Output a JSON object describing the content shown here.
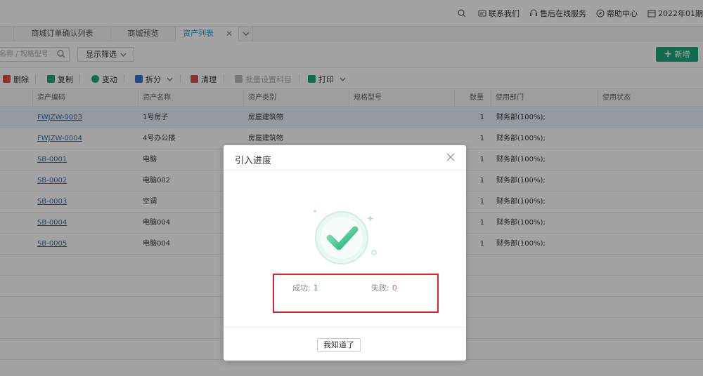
{
  "header": {
    "contact": "联系我们",
    "online_service": "售后在线服务",
    "help": "帮助中心",
    "date": "2022年01期"
  },
  "tabs": [
    {
      "label": "商城订单确认列表",
      "active": false
    },
    {
      "label": "商城预览",
      "active": false
    },
    {
      "label": "资产列表",
      "active": true
    }
  ],
  "search": {
    "placeholder": "名称 / 规格型号",
    "filter_label": "显示筛选",
    "add_label": "新增"
  },
  "toolbar": {
    "delete": "删除",
    "copy": "复制",
    "change": "变动",
    "split": "拆分",
    "clear": "清理",
    "batch_subject": "批量设置科目",
    "print": "打印"
  },
  "table": {
    "columns": [
      "资产编码",
      "资产名称",
      "资产类别",
      "规格型号",
      "数量",
      "使用部门",
      "使用状态"
    ],
    "rows": [
      {
        "code": "FWJZW-0003",
        "name": "1号房子",
        "category": "房屋建筑物",
        "spec": "",
        "qty": "1",
        "dept": "财务部(100%);",
        "status": ""
      },
      {
        "code": "FWJZW-0004",
        "name": "4号办公楼",
        "category": "房屋建筑物",
        "spec": "",
        "qty": "1",
        "dept": "财务部(100%);",
        "status": ""
      },
      {
        "code": "SB-0001",
        "name": "电脑",
        "category": "",
        "spec": "",
        "qty": "1",
        "dept": "财务部(100%);",
        "status": ""
      },
      {
        "code": "SB-0002",
        "name": "电脑002",
        "category": "",
        "spec": "",
        "qty": "1",
        "dept": "财务部(100%);",
        "status": ""
      },
      {
        "code": "SB-0003",
        "name": "空调",
        "category": "",
        "spec": "",
        "qty": "1",
        "dept": "财务部(100%);",
        "status": ""
      },
      {
        "code": "SB-0004",
        "name": "电脑004",
        "category": "",
        "spec": "",
        "qty": "1",
        "dept": "财务部(100%);",
        "status": ""
      },
      {
        "code": "SB-0005",
        "name": "电脑004",
        "category": "",
        "spec": "",
        "qty": "1",
        "dept": "财务部(100%);",
        "status": ""
      }
    ]
  },
  "modal": {
    "title": "引入进度",
    "success_label": "成功:",
    "success_value": "1",
    "fail_label": "失败:",
    "fail_value": "0",
    "confirm": "我知道了"
  },
  "colors": {
    "primary": "#1aaa7e",
    "link": "#2b6cb0",
    "fail": "#e85c4a",
    "highlight_box": "#e0262b"
  }
}
